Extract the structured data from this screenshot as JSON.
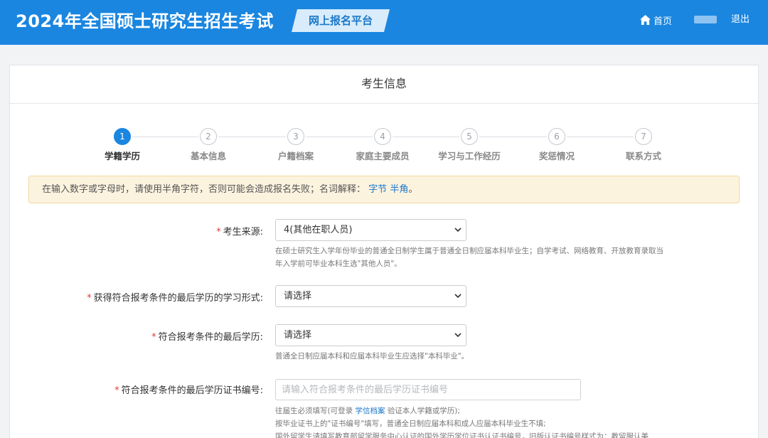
{
  "header": {
    "site_title": "2024年全国硕士研究生招生考试",
    "platform_badge": "网上报名平台",
    "home_label": "首页",
    "logout_label": "退出"
  },
  "card": {
    "title": "考生信息"
  },
  "steps": [
    {
      "num": "1",
      "label": "学籍学历",
      "active": true
    },
    {
      "num": "2",
      "label": "基本信息",
      "active": false
    },
    {
      "num": "3",
      "label": "户籍档案",
      "active": false
    },
    {
      "num": "4",
      "label": "家庭主要成员",
      "active": false
    },
    {
      "num": "5",
      "label": "学习与工作经历",
      "active": false
    },
    {
      "num": "6",
      "label": "奖惩情况",
      "active": false
    },
    {
      "num": "7",
      "label": "联系方式",
      "active": false
    }
  ],
  "notice": {
    "text": "在输入数字或字母时，请使用半角字符，否则可能会造成报名失败；名词解释：",
    "link_byte": "字节",
    "link_halfwidth": "半角",
    "tail": "。"
  },
  "form": {
    "source": {
      "label": "考生来源:",
      "value": "4(其他在职人员)",
      "hint_line1": "在硕士研究生入学年份毕业的普通全日制学生属于普通全日制应届本科毕业生；自学考试、网络教育、开放教育录取当",
      "hint_line2": "年入学前可毕业本科生选\"其他人员\"。"
    },
    "study_form": {
      "label": "获得符合报考条件的最后学历的学习形式:",
      "value": "请选择"
    },
    "last_degree": {
      "label": "符合报考条件的最后学历:",
      "value": "请选择",
      "hint": "普通全日制应届本科和应届本科毕业生应选择\"本科毕业\"。"
    },
    "cert_no": {
      "label": "符合报考条件的最后学历证书编号:",
      "placeholder": "请输入符合报考条件的最后学历证书编号",
      "hint_pre": "往届生必须填写(可登录",
      "hint_link": "学信档案",
      "hint_post": "验证本人学籍或学历);",
      "hint_line2": "按毕业证书上的\"证书编号\"填写，普通全日制应届本科和成人应届本科毕业生不填;",
      "hint_line3": "国外留学生请填写教育部留学服务中心认证的国外学历学位证书认证书编号，旧版认证书编号样式为：教留服认美"
    }
  },
  "colors": {
    "brand": "#1a86e0",
    "required": "#e23b3b",
    "link": "#1a78c8"
  }
}
